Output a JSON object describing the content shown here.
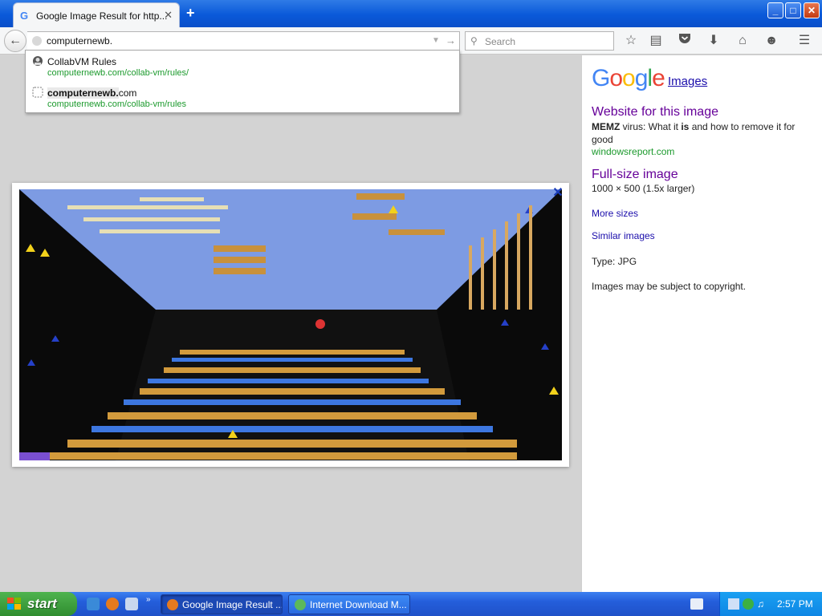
{
  "browser": {
    "tab_title": "Google Image Result for http...",
    "tab_favicon": "G",
    "new_tab_glyph": "+",
    "url_value": "computernewb.",
    "search_placeholder": "Search"
  },
  "window_buttons": {
    "minimize": "_",
    "maximize": "□",
    "close": "✕"
  },
  "autocomplete": [
    {
      "title": "CollabVM Rules",
      "url": "computernewb.com/collab-vm/rules/",
      "icon": "site-favicon-icon"
    },
    {
      "title_hl": "computernewb.",
      "title_rest": "com",
      "url": "computernewb.com/collab-vm/rules",
      "icon": "blank-page-icon"
    }
  ],
  "viewer": {
    "close_glyph": "✕"
  },
  "sidepanel": {
    "logo": "Google",
    "images_link": "Images",
    "website_title": "Website for this image",
    "website_desc_b1": "MEMZ",
    "website_desc_t1": " virus: What it ",
    "website_desc_b2": "is",
    "website_desc_t2": " and how to remove it for good",
    "website_source": "windowsreport.com",
    "fullsize_title": "Full-size image",
    "fullsize_dims": "1000 × 500 (1.5x larger)",
    "more_sizes": "More sizes",
    "similar_images": "Similar images",
    "type_line": "Type:  JPG",
    "copyright": "Images may be subject to copyright."
  },
  "taskbar": {
    "start": "start",
    "task_firefox": "Google Image Result ...",
    "task_idm": "Internet Download M...",
    "clock": "2:57 PM"
  },
  "colors": {
    "accent_blue": "#0a59d9",
    "link_purple": "#660099",
    "link_green": "#1c9a2d",
    "start_green": "#2f8d2f"
  }
}
